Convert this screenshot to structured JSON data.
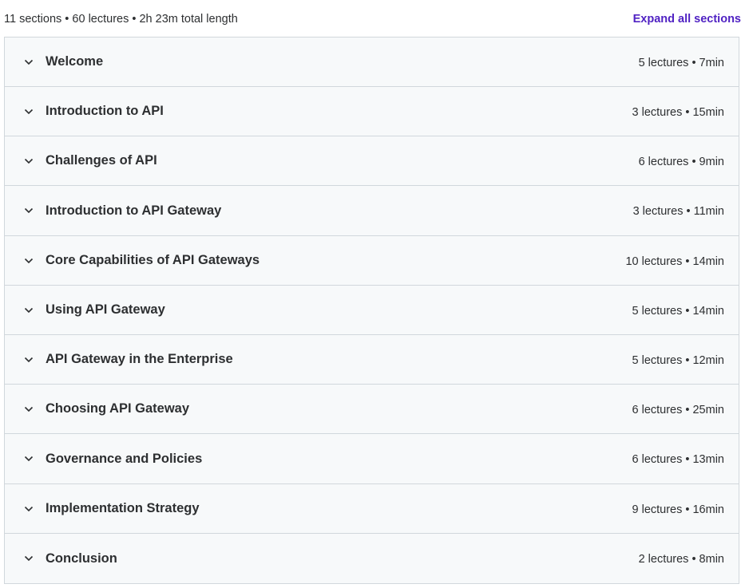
{
  "summary": {
    "text": "11 sections • 60 lectures • 2h 23m total length",
    "expand_label": "Expand all sections"
  },
  "sections": [
    {
      "title": "Welcome",
      "meta": "5 lectures • 7min"
    },
    {
      "title": "Introduction to API",
      "meta": "3 lectures • 15min"
    },
    {
      "title": "Challenges of API",
      "meta": "6 lectures • 9min"
    },
    {
      "title": "Introduction to API Gateway",
      "meta": "3 lectures • 11min"
    },
    {
      "title": "Core Capabilities of API Gateways",
      "meta": "10 lectures • 14min"
    },
    {
      "title": "Using API Gateway",
      "meta": "5 lectures • 14min"
    },
    {
      "title": "API Gateway in the Enterprise",
      "meta": "5 lectures • 12min"
    },
    {
      "title": "Choosing API Gateway",
      "meta": "6 lectures • 25min"
    },
    {
      "title": "Governance and Policies",
      "meta": "6 lectures • 13min"
    },
    {
      "title": "Implementation Strategy",
      "meta": "9 lectures • 16min"
    },
    {
      "title": "Conclusion",
      "meta": "2 lectures • 8min"
    }
  ],
  "icons": {
    "section_toggle": "chevron-down-icon"
  },
  "colors": {
    "accent": "#5022c3",
    "row_background": "#f7f9fa",
    "border": "#d1d7dc",
    "text": "#2d2f31"
  }
}
